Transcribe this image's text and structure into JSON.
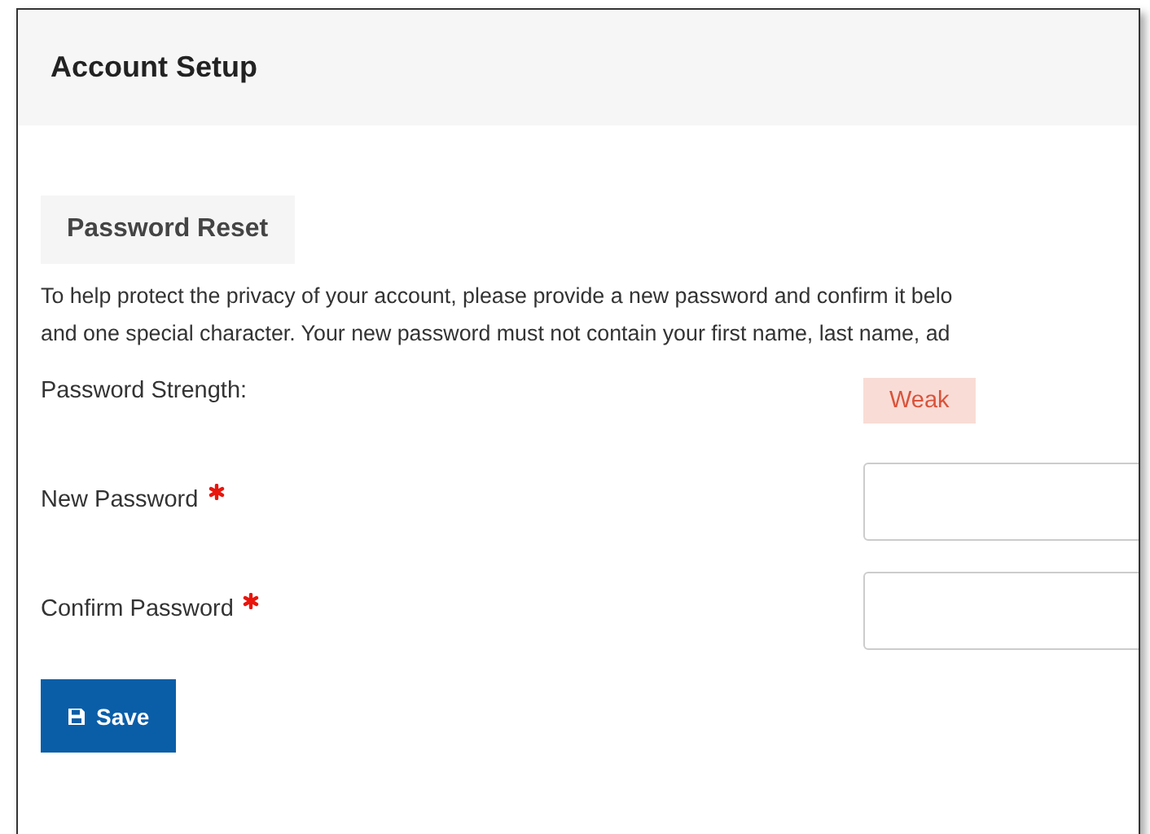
{
  "window": {
    "title": "Account Setup"
  },
  "section": {
    "title": "Password Reset"
  },
  "intro": [
    "To help protect the privacy of your account, please provide a new password and confirm it belo",
    "and one special character. Your new password must not contain your first name, last name, ad"
  ],
  "strength": {
    "label": "Password Strength:",
    "value": "Weak",
    "kind": "weak"
  },
  "fields": [
    {
      "label": "New Password",
      "required": true
    },
    {
      "label": "Confirm Password",
      "required": true
    }
  ],
  "save_button": {
    "label": "Save"
  }
}
